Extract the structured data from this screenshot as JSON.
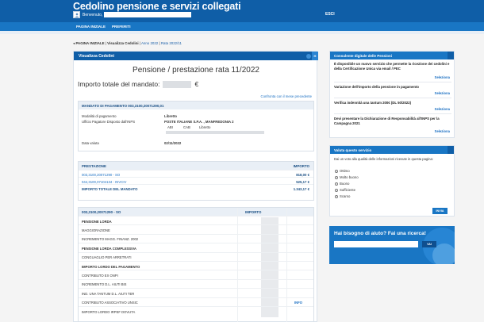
{
  "header": {
    "site_title": "Cedolino pensione e servizi collegati",
    "welcome_label": "Benvenuto,",
    "logout_label": "ESCI"
  },
  "nav": {
    "items": [
      {
        "label": "PAGINA INIZIALE"
      },
      {
        "label": "PREFERITI"
      }
    ]
  },
  "breadcrumb": {
    "arrow": "◂",
    "items": [
      {
        "label": "PAGINA INIZIALE"
      },
      {
        "label": "Visualizza Cedolini"
      },
      {
        "label": "Anno 2022"
      },
      {
        "label": "Rata 2022/11"
      }
    ],
    "separator": "|"
  },
  "main": {
    "panel_title": "Visualizza Cedolini",
    "corner_badge": "H",
    "heading": "Pensione / prestazione rata 11/2022",
    "total_label": "Importo totale del mandato:",
    "total_currency": "€",
    "compare_link": "Confronta con il mese precedente",
    "payment": {
      "header": "MANDATO DI PAGAMENTO 003,3100,20071290,01",
      "modality_label": "Modalità di pagamento",
      "modality_value": "Libretto",
      "office_label": "Ufficio Pagatore Disposto dall'INPS",
      "office_value": "POSTE ITALIANE S.P.A. , MANFREDONIA 2",
      "abi_label": "ABI",
      "cab_label": "CAB",
      "booklet_label": "Libretto",
      "value_date_label": "Data valuta",
      "value_date": "02/11/2022"
    },
    "benefits": {
      "col_label": "PRESTAZIONE",
      "col_amount": "IMPORTO",
      "rows": [
        {
          "label": "003,3100,20071290 - SO",
          "amount": "818,00 €"
        },
        {
          "label": "044,3100,07104134 - INVCIV",
          "amount": "525,17 €"
        }
      ],
      "total_label": "IMPORTO TOTALE DEL MANDATO",
      "total_amount": "1.343,17 €"
    },
    "detail": {
      "col_label": "003,3100,20071290 - SO",
      "col_amount": "IMPORTO",
      "rows": [
        {
          "label": "PENSIONE LORDA",
          "bold": true
        },
        {
          "label": "MAGGIORAZIONE",
          "bold": false
        },
        {
          "label": "INCREMENTO MAGG. FINANZ. 2002",
          "bold": false
        },
        {
          "label": "PENSIONE LORDA COMPLESSIVA",
          "bold": true
        },
        {
          "label": "CONGUAGLIO PER ARRETRATI",
          "bold": false
        },
        {
          "label": "IMPORTO LORDO DEL PAGAMENTO",
          "bold": true
        },
        {
          "label": "CONTRIBUTO EX ONPI",
          "bold": false
        },
        {
          "label": "INCREMENTO D.L. AIUTI BIS",
          "bold": false
        },
        {
          "label": "IND. UNA TANTUM D.L. AIUTI TER",
          "bold": false
        },
        {
          "label": "CONTRIBUTO ASSOCIATIVO UNSIC",
          "bold": false,
          "info": "INFO"
        },
        {
          "label": "IMPORTO LORDO IRPEF DOVUTA",
          "bold": false
        }
      ]
    }
  },
  "sidebar": {
    "digital": {
      "title": "Consulente digitale delle Pensioni",
      "items": [
        {
          "text": "È disponibile un nuovo servizio che permette la ricezione dei cedolini e della Certificazione Unica via email / PEC",
          "link": "Seleziona"
        },
        {
          "text": "Variazione dell'importo della pensione in pagamento",
          "link": "Seleziona"
        },
        {
          "text": "Verifica indennità una tantum 200€ (DL 50/2022)",
          "link": "Seleziona"
        },
        {
          "text": "Devi presentare la Dichiarazione di Responsabilità all'INPS per la Campagna 2021",
          "link": "Seleziona"
        }
      ]
    },
    "survey": {
      "title": "Valuta questo servizio",
      "question": "Dai un voto alla qualità delle informazioni ricevute in questa pagina:",
      "options": [
        "Ottimo",
        "Molto buono",
        "Buono",
        "Sufficiente",
        "Scarso"
      ],
      "send_label": "INVIA"
    },
    "help": {
      "title": "Hai bisogno di aiuto? Fai una ricerca!",
      "button_label": "VAI"
    }
  },
  "colors": {
    "header_blue": "#0f5ea7",
    "nav_blue": "#1976c4",
    "link_blue": "#1a6fc2"
  }
}
